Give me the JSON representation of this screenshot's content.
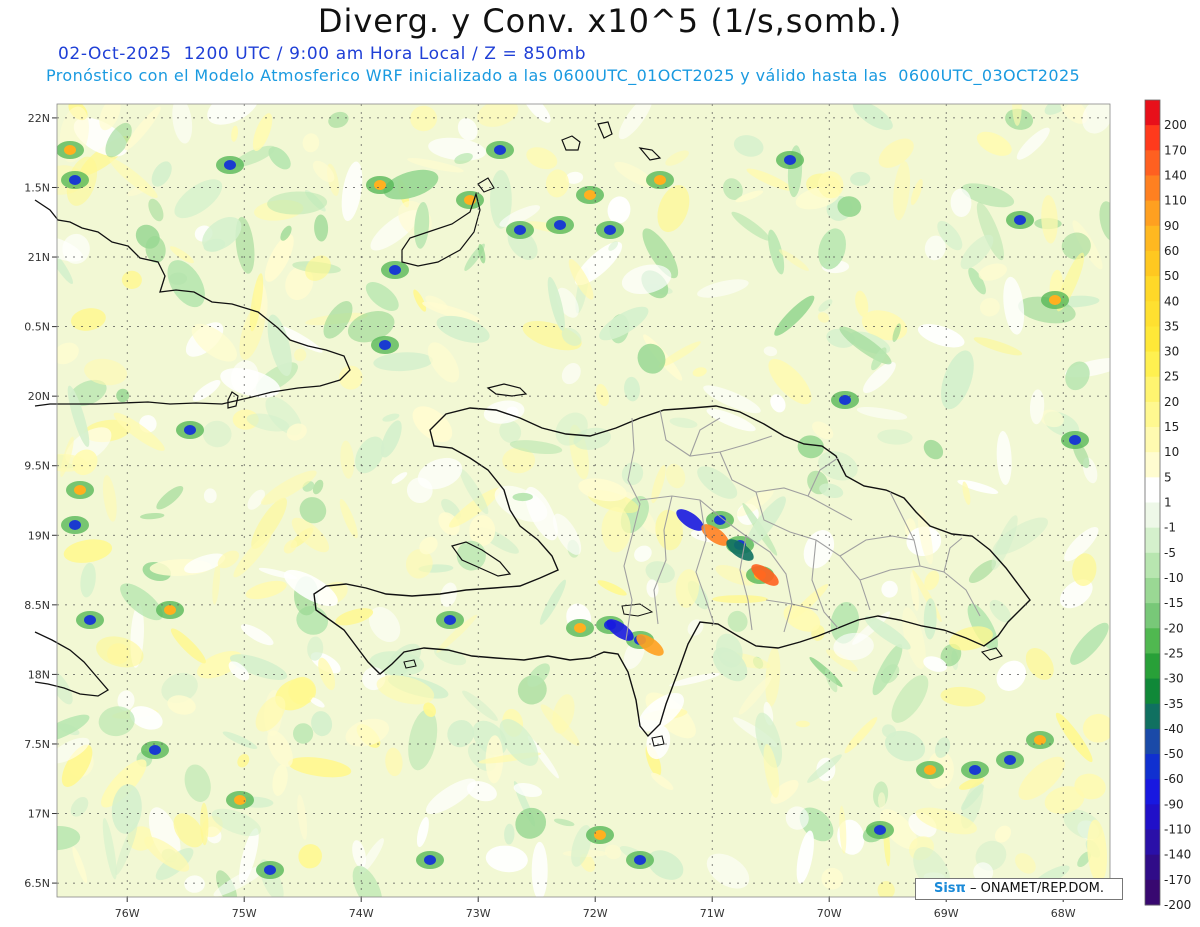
{
  "header": {
    "title": "Diverg. y Conv. x10^5 (1/s,somb.)",
    "valid_line": "02-Oct-2025  1200 UTC / 9:00 am Hora Local / Z = 850mb",
    "model_line": "Pronóstico con el Modelo Atmosferico WRF inicializado a las 0600UTC_01OCT2025 y válido hasta las  0600UTC_03OCT2025"
  },
  "map": {
    "lon_range": [
      -76.6,
      -67.6
    ],
    "lat_range": [
      16.4,
      22.1
    ],
    "lat_ticks": [
      {
        "value": 22.0,
        "label": "22N"
      },
      {
        "value": 21.5,
        "label": "1.5N"
      },
      {
        "value": 21.0,
        "label": "21N"
      },
      {
        "value": 20.5,
        "label": "0.5N"
      },
      {
        "value": 20.0,
        "label": "20N"
      },
      {
        "value": 19.5,
        "label": "9.5N"
      },
      {
        "value": 19.0,
        "label": "19N"
      },
      {
        "value": 18.5,
        "label": "8.5N"
      },
      {
        "value": 18.0,
        "label": "18N"
      },
      {
        "value": 17.5,
        "label": "7.5N"
      },
      {
        "value": 17.0,
        "label": "17N"
      },
      {
        "value": 16.5,
        "label": "6.5N"
      }
    ],
    "lon_ticks": [
      {
        "value": -76,
        "label": "76W"
      },
      {
        "value": -75,
        "label": "75W"
      },
      {
        "value": -74,
        "label": "74W"
      },
      {
        "value": -73,
        "label": "73W"
      },
      {
        "value": -72,
        "label": "72W"
      },
      {
        "value": -71,
        "label": "71W"
      },
      {
        "value": -70,
        "label": "70W"
      },
      {
        "value": -69,
        "label": "69W"
      },
      {
        "value": -68,
        "label": "68W"
      }
    ],
    "colors": {
      "background": "#f2f8d4",
      "coast": "#111111",
      "borders": "#a0a0a0",
      "grid": "#555555"
    }
  },
  "colorbar": {
    "labels": [
      "200",
      "170",
      "140",
      "110",
      "90",
      "60",
      "50",
      "40",
      "35",
      "30",
      "25",
      "20",
      "15",
      "10",
      "5",
      "1",
      "-1",
      "-5",
      "-10",
      "-15",
      "-20",
      "-25",
      "-30",
      "-35",
      "-40",
      "-50",
      "-60",
      "-90",
      "-110",
      "-140",
      "-170",
      "-200"
    ],
    "colors": [
      "#e8101a",
      "#ff3a1c",
      "#ff6020",
      "#ff8020",
      "#ffa020",
      "#ffb820",
      "#ffc820",
      "#ffd828",
      "#ffe030",
      "#ffe838",
      "#fff050",
      "#fff470",
      "#fff890",
      "#fffab0",
      "#fffcd0",
      "#ffffff",
      "#eef8e8",
      "#d4f0cc",
      "#b8e6b0",
      "#9ad894",
      "#78c878",
      "#50b850",
      "#28a038",
      "#108838",
      "#107060",
      "#1a4aa8",
      "#1030d0",
      "#1818e0",
      "#2010c8",
      "#2a10a8",
      "#300c88",
      "#380870"
    ]
  },
  "credit": {
    "brand": "Sisπ",
    "text": "– ONAMET/REP.DOM."
  },
  "regions": {
    "cuba": "cuba-coast",
    "hispaniola": "hispaniola-coast",
    "jamaica": "jamaica-coast"
  }
}
